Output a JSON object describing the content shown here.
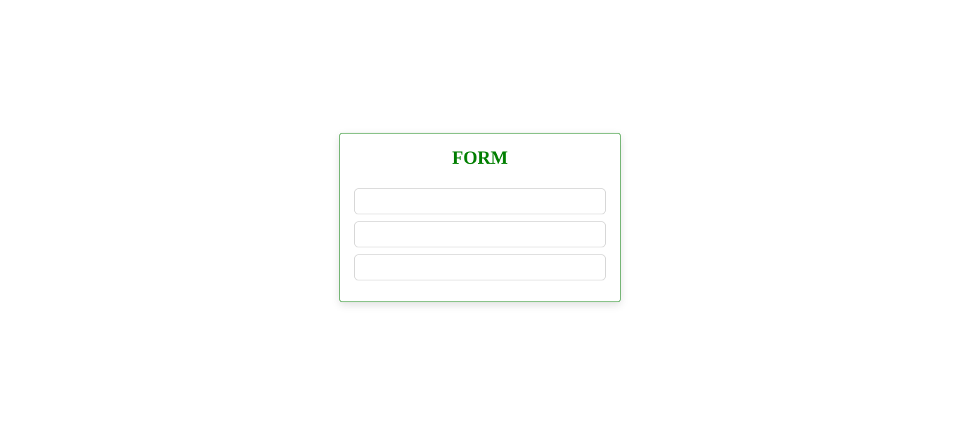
{
  "form": {
    "title": "FORM",
    "accent_color": "#008000",
    "border_color": "#3a9a3a",
    "fields": [
      {
        "value": "",
        "placeholder": ""
      },
      {
        "value": "",
        "placeholder": ""
      },
      {
        "value": "",
        "placeholder": ""
      }
    ]
  }
}
